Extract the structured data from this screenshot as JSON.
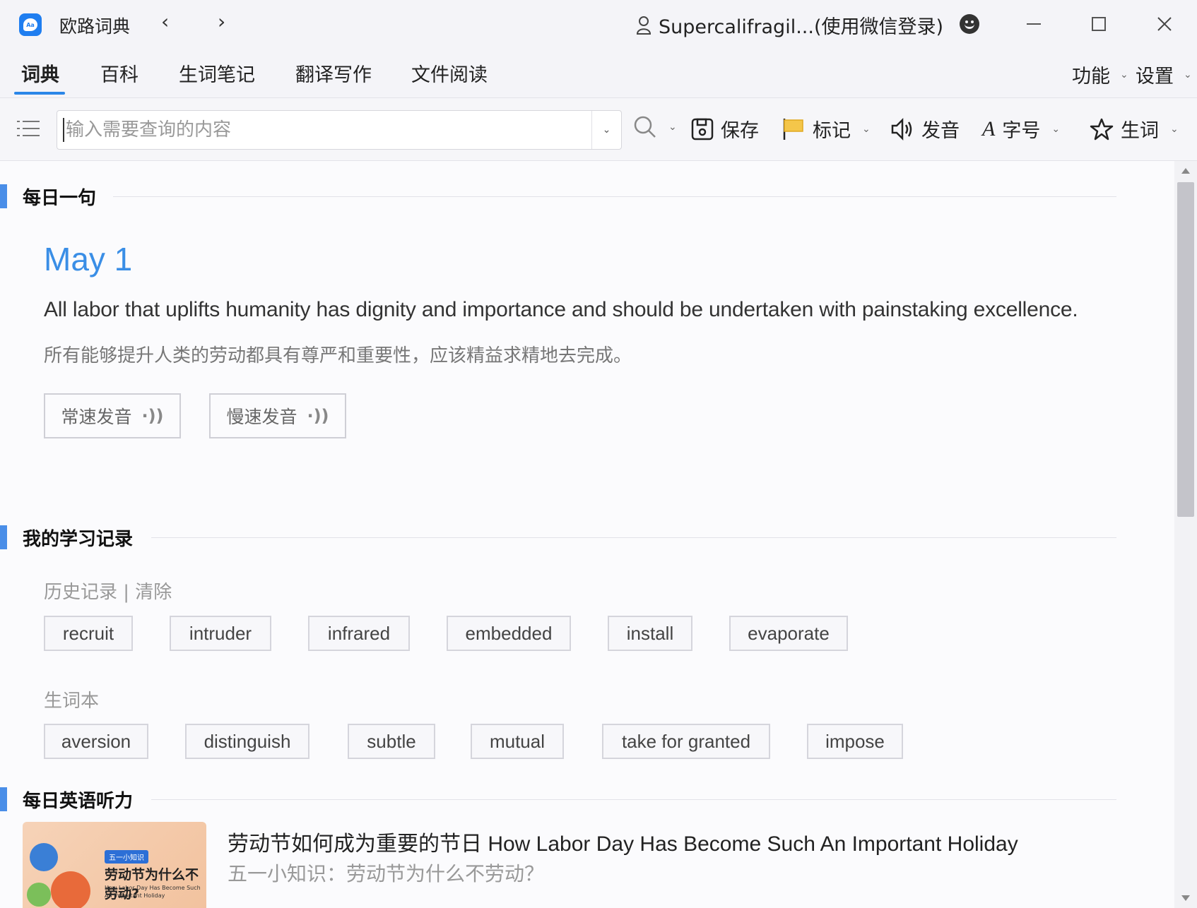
{
  "window": {
    "app_title": "欧路词典",
    "back_icon": "‹",
    "forward_icon": "›",
    "user_label": "Supercalifragil...(使用微信登录)"
  },
  "tabs": [
    {
      "label": "词典",
      "active": true
    },
    {
      "label": "百科"
    },
    {
      "label": "生词笔记"
    },
    {
      "label": "翻译写作"
    },
    {
      "label": "文件阅读"
    }
  ],
  "right_menu": {
    "features": "功能",
    "settings": "设置"
  },
  "toolbar": {
    "search_placeholder": "输入需要查询的内容",
    "save": "保存",
    "mark": "标记",
    "pronounce": "发音",
    "font_size": "字号",
    "new_word": "生词"
  },
  "daily_sentence": {
    "section_title": "每日一句",
    "date": "May 1",
    "english": "All labor that uplifts humanity has dignity and importance and should be undertaken with painstaking excellence.",
    "chinese": "所有能够提升人类的劳动都具有尊严和重要性，应该精益求精地去完成。",
    "normal_speed": "常速发音",
    "slow_speed": "慢速发音",
    "wave_icon": "·))"
  },
  "study_record": {
    "section_title": "我的学习记录",
    "history_label": "历史记录 | 清除",
    "history": [
      "recruit",
      "intruder",
      "infrared",
      "embedded",
      "install",
      "evaporate"
    ],
    "wordbook_label": "生词本",
    "wordbook": [
      "aversion",
      "distinguish",
      "subtle",
      "mutual",
      "take for granted",
      "impose"
    ]
  },
  "listening": {
    "section_title": "每日英语听力",
    "title": "劳动节如何成为重要的节日 How Labor Day Has Become Such An Important Holiday",
    "subtitle": "五一小知识：劳动节为什么不劳动？",
    "thumb_tag": "五一小知识",
    "thumb_title": "劳动节为什么不劳动?",
    "thumb_sub": "How Labor Day Has Become Such An Important Holiday"
  },
  "colors": {
    "accent": "#2a86e8",
    "section_bar": "#4a8ee8",
    "date": "#3a8ee6"
  }
}
